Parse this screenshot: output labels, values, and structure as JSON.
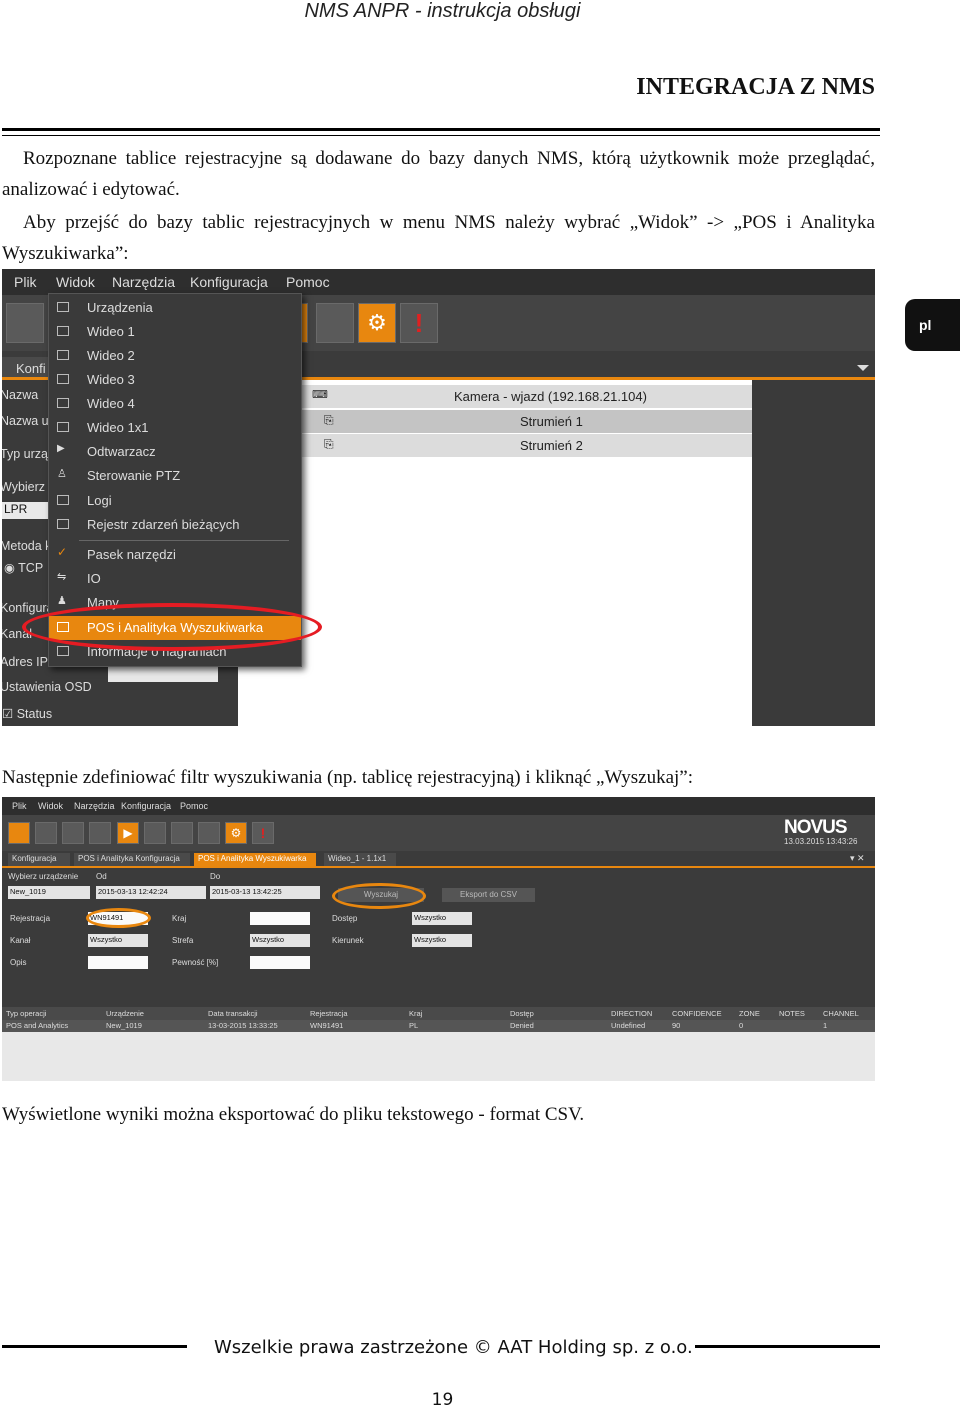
{
  "header": {
    "title": "NMS ANPR - instrukcja obsługi",
    "section": "INTEGRACJA Z NMS"
  },
  "paragraphs": {
    "p1": "Rozpoznane tablice rejestracyjne są dodawane do bazy danych NMS, którą użytkownik może przeglądać, analizować i edytować.",
    "p2": "Aby przejść do bazy tablic rejestracyjnych w menu NMS należy wybrać „Widok” -> „POS i Analityka Wyszukiwarka”:",
    "p3": "Następnie zdefiniować filtr wyszukiwania (np. tablicę rejestracyjną) i kliknąć „Wyszukaj”:",
    "p4": "Wyświetlone wyniki można eksportować do pliku tekstowego - format CSV."
  },
  "side_tab": "pl",
  "screenshot1": {
    "menu": [
      "Plik",
      "Widok",
      "Narzędzia",
      "Konfiguracja",
      "Pomoc"
    ],
    "konfi_tab": "Konfi",
    "left_labels": [
      "Nazwa",
      "Nazwa ur",
      "Typ urzą",
      "Wybierz",
      "LPR",
      "Metoda k",
      "TCP",
      "Konfigura",
      "Kanał",
      "Adres IP",
      "Ustawienia OSD",
      "Status"
    ],
    "tree": {
      "camera": "Kamera - wjazd (192.168.21.104)",
      "stream1": "Strumień 1",
      "stream2": "Strumień 2"
    },
    "dropdown": [
      "Urządzenia",
      "Wideo 1",
      "Wideo 2",
      "Wideo 3",
      "Wideo 4",
      "Wideo 1x1",
      "Odtwarzacz",
      "Sterowanie PTZ",
      "Logi",
      "Rejestr zdarzeń bieżących",
      "Pasek narzędzi",
      "IO",
      "Mapy",
      "POS i Analityka Wyszukiwarka",
      "Informacje o nagraniach"
    ]
  },
  "screenshot2": {
    "menu": [
      "Plik",
      "Widok",
      "Narzędzia",
      "Konfiguracja",
      "Pomoc"
    ],
    "brand": "NOVUS",
    "datetime": "13.03.2015 13:43:26",
    "tabs": [
      "Konfiguracja",
      "POS i Analityka Konfiguracja",
      "POS i Analityka Wyszukiwarka",
      "Wideo_1 - 1.1x1"
    ],
    "device_label": "Wybierz urządzenie",
    "device_value": "New_1019",
    "od_label": "Od",
    "od_value": "2015-03-13   12:42:24",
    "do_label": "Do",
    "do_value": "2015-03-13   13:42:25",
    "search_btn": "Wyszukaj",
    "export_btn": "Eksport do CSV",
    "fields": {
      "rejestracja": "Rejestracja",
      "rejestracja_val": "WN91491",
      "kraj": "Kraj",
      "dostep": "Dostęp",
      "dostep_val": "Wszystko",
      "kanal": "Kanał",
      "kanal_val": "Wszystko",
      "strefa": "Strefa",
      "strefa_val": "Wszystko",
      "kierunek": "Kierunek",
      "kierunek_val": "Wszystko",
      "opis": "Opis",
      "pewnosc": "Pewność [%]"
    },
    "table_headers": [
      "Typ operacji",
      "Urządzenie",
      "Data transakcji",
      "Rejestracja",
      "Kraj",
      "Dostęp",
      "DIRECTION",
      "CONFIDENCE",
      "ZONE",
      "NOTES",
      "CHANNEL"
    ],
    "table_row": [
      "POS and Analytics",
      "New_1019",
      "13-03-2015 13:33:25",
      "WN91491",
      "PL",
      "Denied",
      "Undefined",
      "90",
      "0",
      "",
      "1"
    ]
  },
  "footer": {
    "copyright": "Wszelkie prawa zastrzeżone © AAT Holding sp. z o.o.",
    "page": "19"
  },
  "colors": {
    "accent": "#e8870f",
    "highlight_ellipse": "#e51c23",
    "app_bg": "#3b3b3b"
  }
}
